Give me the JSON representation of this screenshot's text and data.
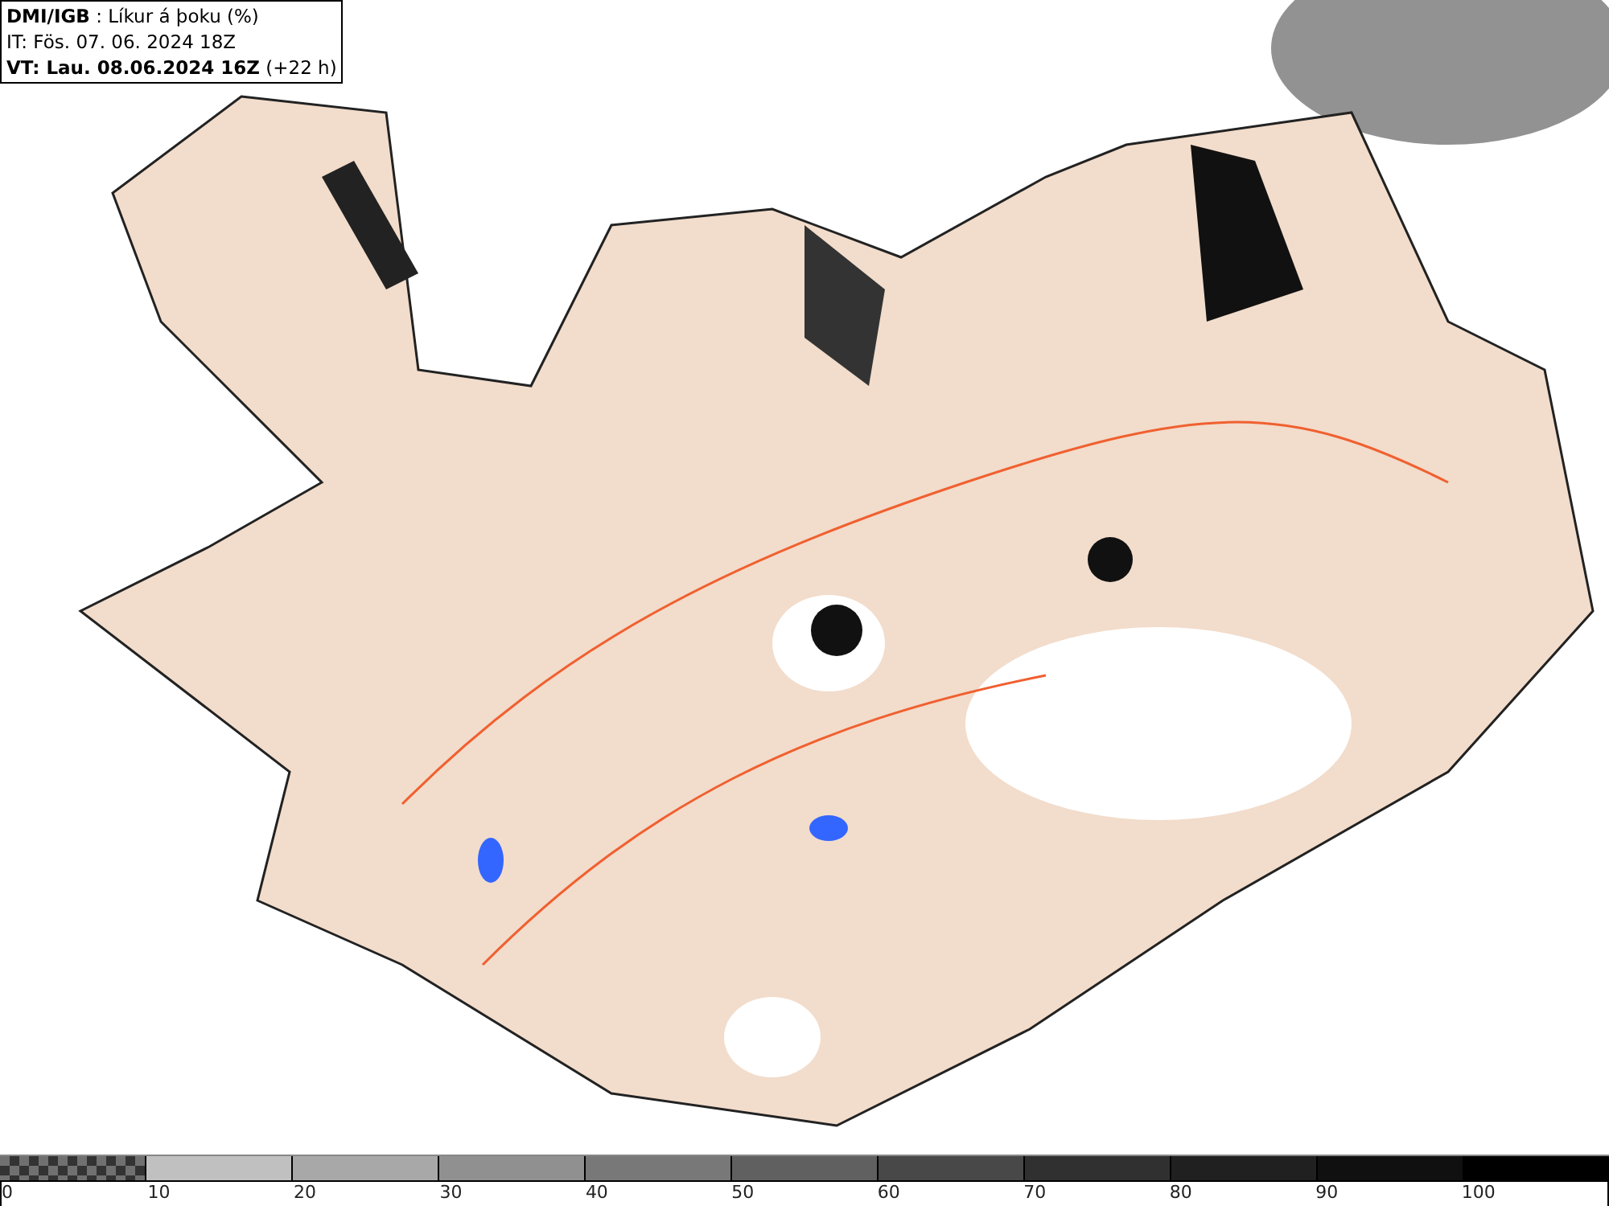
{
  "header": {
    "line_1": "**DMI/IGB** : Líkur á þoku (%)",
    "line_2": "IT: Fös. 07. 06. 2024 18Z",
    "line_3": "**VT: Lau. 08.06.2024 16Z** (+22 h)"
  },
  "legend": [
    {
      "kind": "checker",
      "color": "#707070",
      "label": "0"
    },
    {
      "kind": "solid",
      "color": "#c0c0c0",
      "label": "10"
    },
    {
      "kind": "solid",
      "color": "#a8a8a8",
      "label": "20"
    },
    {
      "kind": "solid",
      "color": "#909090",
      "label": "30"
    },
    {
      "kind": "solid",
      "color": "#787878",
      "label": "40"
    },
    {
      "kind": "solid",
      "color": "#606060",
      "label": "50"
    },
    {
      "kind": "solid",
      "color": "#484848",
      "label": "60"
    },
    {
      "kind": "solid",
      "color": "#303030",
      "label": "70"
    },
    {
      "kind": "solid",
      "color": "#202020",
      "label": "80"
    },
    {
      "kind": "solid",
      "color": "#101010",
      "label": "90"
    },
    {
      "kind": "solid",
      "color": "#000000",
      "label": "100"
    }
  ]
}
